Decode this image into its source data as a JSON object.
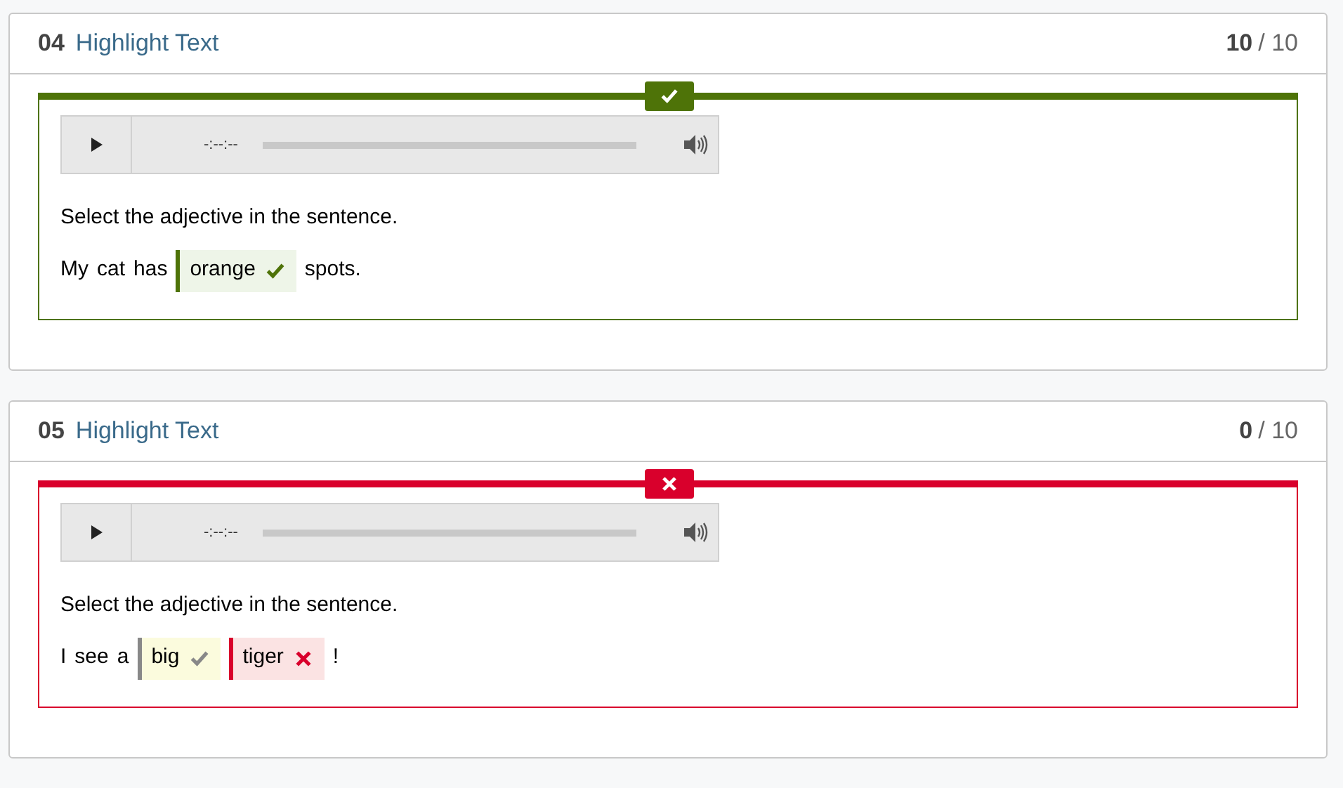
{
  "questions": [
    {
      "number": "04",
      "title": "Highlight Text",
      "score": "10",
      "total": "/ 10",
      "correct": true,
      "audio": {
        "time": "-:--:--"
      },
      "prompt": "Select the adjective in the sentence.",
      "tokens": [
        {
          "text": "My",
          "kind": "plain"
        },
        {
          "text": "cat",
          "kind": "plain"
        },
        {
          "text": "has",
          "kind": "plain"
        },
        {
          "text": "orange",
          "kind": "option",
          "selected": true,
          "correct": true
        },
        {
          "text": "spots.",
          "kind": "plain"
        }
      ]
    },
    {
      "number": "05",
      "title": "Highlight Text",
      "score": "0",
      "total": "/ 10",
      "correct": false,
      "audio": {
        "time": "-:--:--"
      },
      "prompt": "Select the adjective in the sentence.",
      "tokens": [
        {
          "text": "I",
          "kind": "plain"
        },
        {
          "text": "see",
          "kind": "plain"
        },
        {
          "text": "a",
          "kind": "plain"
        },
        {
          "text": "big",
          "kind": "option",
          "selected": false,
          "correct": true
        },
        {
          "text": "tiger",
          "kind": "option",
          "selected": true,
          "correct": false
        },
        {
          "text": "!",
          "kind": "plain"
        }
      ]
    }
  ]
}
